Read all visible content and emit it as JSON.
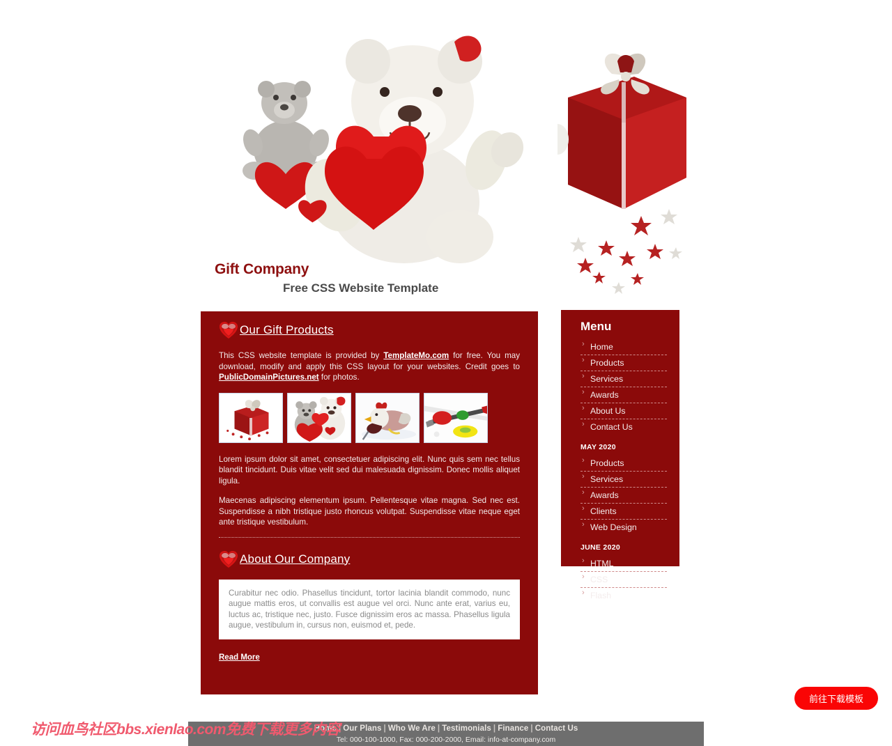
{
  "header": {
    "site_title": "Gift Company",
    "slogan": "Free CSS Website Template",
    "hero_left_alt": "two-teddy-bears-with-red-hearts",
    "hero_right_alt": "red-glitter-gift-box-with-stars"
  },
  "content": {
    "products_section": {
      "heading": "Our Gift Products",
      "intro_part1": "This CSS website template is provided by ",
      "intro_link1": "TemplateMo.com",
      "intro_part2": " for free. You may download, modify and apply this CSS layout for your websites. Credit goes to ",
      "intro_link2": "PublicDomainPictures.net",
      "intro_part3": " for photos.",
      "thumbnails": [
        {
          "alt": "red-gift-box-thumbnail"
        },
        {
          "alt": "teddy-bears-hearts-thumbnail"
        },
        {
          "alt": "rooster-toy-thumbnail"
        },
        {
          "alt": "paint-brushes-thumbnail"
        }
      ],
      "paragraph1": "Lorem ipsum dolor sit amet, consectetuer adipiscing elit. Nunc quis sem nec tellus blandit tincidunt. Duis vitae velit sed dui malesuada dignissim. Donec mollis aliquet ligula.",
      "paragraph2": "Maecenas adipiscing elementum ipsum. Pellentesque vitae magna. Sed nec est. Suspendisse a nibh tristique justo rhoncus volutpat. Suspendisse vitae neque eget ante tristique vestibulum."
    },
    "about_section": {
      "heading": "About Our Company",
      "quote": "Curabitur nec odio. Phasellus tincidunt, tortor lacinia blandit commodo, nunc augue mattis eros, ut convallis est augue vel orci. Nunc ante erat, varius eu, luctus ac, tristique nec, justo. Fusce dignissim eros ac massa. Phasellus ligula augue, vestibulum in, cursus non, euismod et, pede.",
      "read_more": "Read More"
    }
  },
  "sidebar": {
    "title": "Menu",
    "main_items": [
      {
        "label": "Home"
      },
      {
        "label": "Products"
      },
      {
        "label": "Services"
      },
      {
        "label": "Awards"
      },
      {
        "label": "About Us"
      },
      {
        "label": "Contact Us"
      }
    ],
    "group_may": {
      "heading": "MAY 2020",
      "items": [
        {
          "label": "Products"
        },
        {
          "label": "Services"
        },
        {
          "label": "Awards"
        },
        {
          "label": "Clients"
        },
        {
          "label": "Web Design"
        }
      ]
    },
    "group_june": {
      "heading": "JUNE 2020",
      "items": [
        {
          "label": "HTML"
        },
        {
          "label": "CSS"
        },
        {
          "label": "Flash"
        }
      ]
    }
  },
  "footer": {
    "nav": [
      {
        "label": "Home"
      },
      {
        "label": "Our Plans"
      },
      {
        "label": "Who We Are"
      },
      {
        "label": "Testimonials"
      },
      {
        "label": "Finance"
      },
      {
        "label": "Contact Us"
      }
    ],
    "separator": "|",
    "contact": "Tel: 000-100-1000, Fax: 000-200-2000, Email: info-at-company.com"
  },
  "overlay": {
    "watermark": "访问血鸟社区bbs.xienlao.com免费下载更多内容",
    "download_button": "前往下载模板"
  },
  "colors": {
    "brand_red": "#8b0a0a",
    "title_red": "#8e1010",
    "footer_gray": "#6e6e6e",
    "button_red": "#fa0505",
    "watermark_pink": "#f05a6e"
  }
}
